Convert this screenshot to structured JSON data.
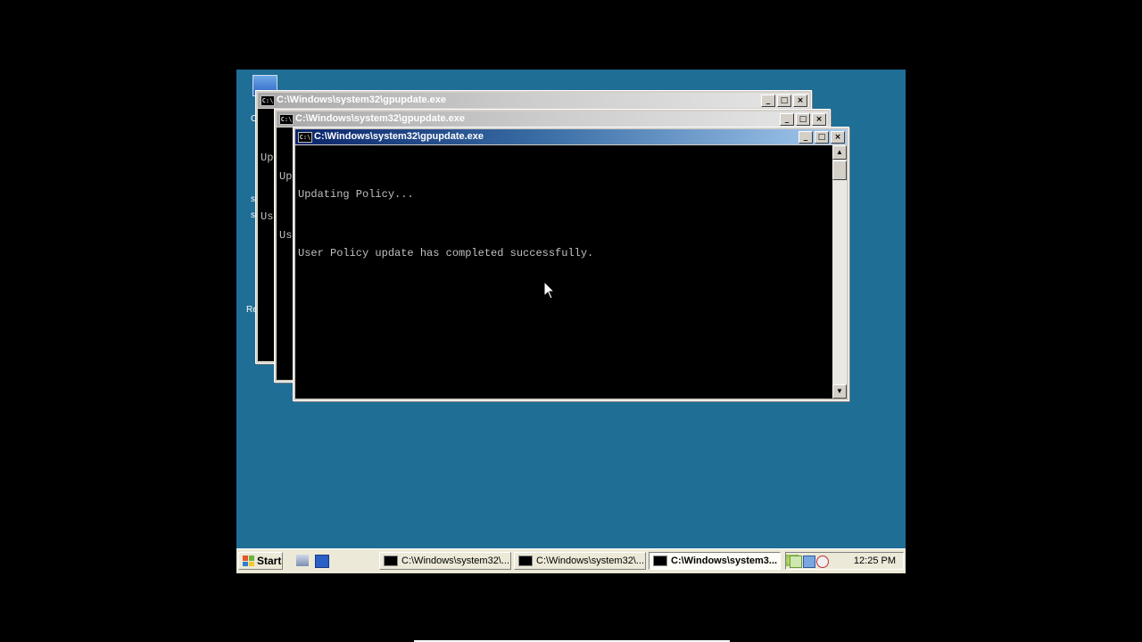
{
  "desktop": {
    "fragments": [
      "C",
      "Us",
      "s",
      "Re"
    ]
  },
  "windows": [
    {
      "title": "C:\\Windows\\system32\\gpupdate.exe",
      "icon_text": "C:\\",
      "lines": [
        "Up",
        "Us"
      ],
      "state": "inactive"
    },
    {
      "title": "C:\\Windows\\system32\\gpupdate.exe",
      "icon_text": "C:\\",
      "lines": [
        "Up",
        "Us"
      ],
      "state": "inactive"
    },
    {
      "title": "C:\\Windows\\system32\\gpupdate.exe",
      "icon_text": "C:\\",
      "lines": [
        "Updating Policy...",
        "User Policy update has completed successfully."
      ],
      "state": "active"
    }
  ],
  "titlebar_buttons": {
    "minimize": "_",
    "maximize": "□",
    "close": "×"
  },
  "scrollbar": {
    "up": "▲",
    "down": "▼"
  },
  "taskbar": {
    "start_label": "Start",
    "tasks": [
      {
        "label": "C:\\Windows\\system32\\...",
        "active": false
      },
      {
        "label": "C:\\Windows\\system32\\...",
        "active": false
      },
      {
        "label": "C:\\Windows\\system3...",
        "active": true
      }
    ],
    "clock": "12:25 PM"
  },
  "colors": {
    "desktop": "#1f6e96",
    "active_title_start": "#0a246a",
    "active_title_end": "#a6caf0",
    "console_bg": "#000000",
    "console_fg": "#c0c0c0"
  }
}
